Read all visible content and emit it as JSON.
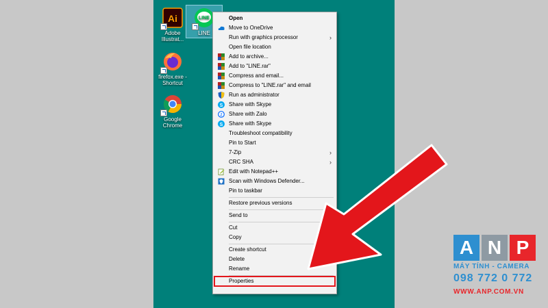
{
  "desktop": {
    "icons": [
      {
        "label": "Adobe Illustrat...",
        "icon": "illustrator-icon"
      },
      {
        "label": "LINE",
        "icon": "line-icon"
      },
      {
        "label": "firefox.exe - Shortcut",
        "icon": "firefox-icon"
      },
      {
        "label": "Google Chrome",
        "icon": "chrome-icon"
      }
    ]
  },
  "context_menu": {
    "items": [
      {
        "label": "Open"
      },
      {
        "label": "Move to OneDrive"
      },
      {
        "label": "Run with graphics processor"
      },
      {
        "label": "Open file location"
      },
      {
        "label": "Add to archive..."
      },
      {
        "label": "Add to \"LINE.rar\""
      },
      {
        "label": "Compress and email..."
      },
      {
        "label": "Compress to \"LINE.rar\" and email"
      },
      {
        "label": "Run as administrator"
      },
      {
        "label": "Share with Skype"
      },
      {
        "label": "Share with Zalo"
      },
      {
        "label": "Share with Skype"
      },
      {
        "label": "Troubleshoot compatibility"
      },
      {
        "label": "Pin to Start"
      },
      {
        "label": "7-Zip"
      },
      {
        "label": "CRC SHA"
      },
      {
        "label": "Edit with Notepad++"
      },
      {
        "label": "Scan with Windows Defender..."
      },
      {
        "label": "Pin to taskbar"
      },
      {
        "label": "Restore previous versions"
      },
      {
        "label": "Send to"
      },
      {
        "label": "Cut"
      },
      {
        "label": "Copy"
      },
      {
        "label": "Create shortcut"
      },
      {
        "label": "Delete"
      },
      {
        "label": "Rename"
      },
      {
        "label": "Properties"
      }
    ],
    "submenu_glyph": "›"
  },
  "watermark": {
    "letters": [
      "A",
      "N",
      "P"
    ],
    "tagline": "MÁY TÍNH - CAMERA",
    "phone": "098 772 0 772",
    "website": "WWW.ANP.COM.VN"
  },
  "colors": {
    "desktop": "#00807a",
    "arrow": "#e3161b",
    "highlight_border": "#e3161b",
    "logo_blue": "#2e8fd0",
    "logo_red": "#e8262b",
    "logo_grey": "#8e9aa3"
  }
}
